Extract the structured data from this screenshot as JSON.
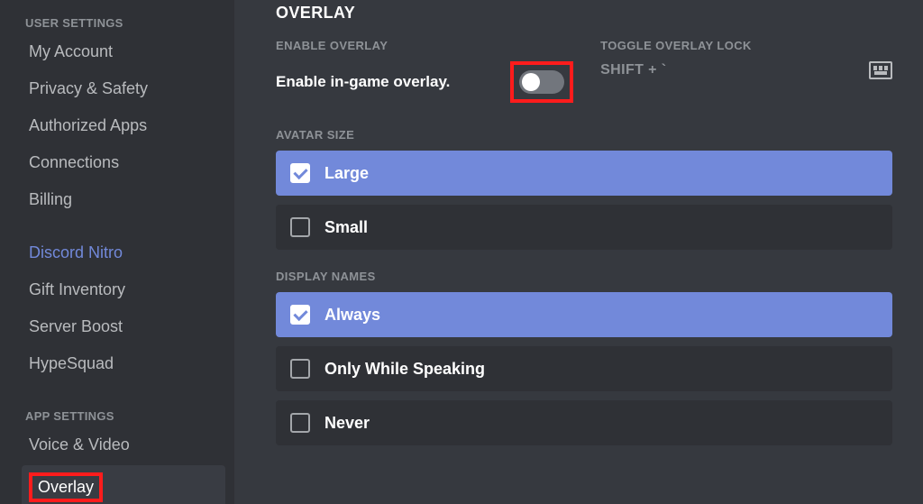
{
  "sidebar": {
    "userSettingsHeader": "USER SETTINGS",
    "items": [
      {
        "label": "My Account"
      },
      {
        "label": "Privacy & Safety"
      },
      {
        "label": "Authorized Apps"
      },
      {
        "label": "Connections"
      },
      {
        "label": "Billing"
      }
    ],
    "nitro": {
      "label": "Discord Nitro"
    },
    "items2": [
      {
        "label": "Gift Inventory"
      },
      {
        "label": "Server Boost"
      },
      {
        "label": "HypeSquad"
      }
    ],
    "appSettingsHeader": "APP SETTINGS",
    "appItems": [
      {
        "label": "Voice & Video"
      },
      {
        "label": "Overlay",
        "selected": true
      }
    ]
  },
  "overlay": {
    "title": "OVERLAY",
    "enableOverlayHeader": "ENABLE OVERLAY",
    "enableOverlayLabel": "Enable in-game overlay.",
    "enableOverlayState": false,
    "toggleLockHeader": "TOGGLE OVERLAY LOCK",
    "toggleLockValue": "SHIFT + `",
    "avatarSize": {
      "header": "AVATAR SIZE",
      "options": [
        {
          "label": "Large",
          "selected": true
        },
        {
          "label": "Small",
          "selected": false
        }
      ]
    },
    "displayNames": {
      "header": "DISPLAY NAMES",
      "options": [
        {
          "label": "Always",
          "selected": true
        },
        {
          "label": "Only While Speaking",
          "selected": false
        },
        {
          "label": "Never",
          "selected": false
        }
      ]
    }
  }
}
